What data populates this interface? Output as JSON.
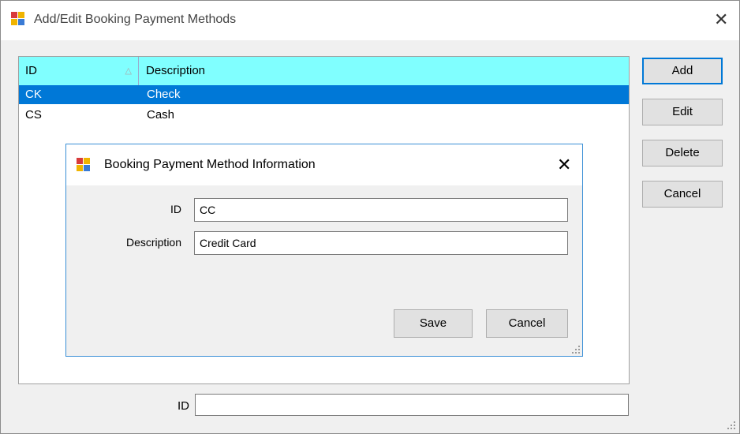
{
  "window": {
    "title": "Add/Edit Booking Payment Methods"
  },
  "grid": {
    "columns": [
      "ID",
      "Description"
    ],
    "sort_indicator": "△",
    "rows": [
      {
        "id": "CK",
        "description": "Check",
        "selected": true
      },
      {
        "id": "CS",
        "description": "Cash",
        "selected": false
      }
    ]
  },
  "buttons": {
    "add": "Add",
    "edit": "Edit",
    "delete": "Delete",
    "cancel": "Cancel"
  },
  "bottom": {
    "id_label": "ID",
    "id_value": ""
  },
  "dialog": {
    "title": "Booking Payment Method Information",
    "id_label": "ID",
    "id_value": "CC",
    "description_label": "Description",
    "description_value": "Credit Card",
    "save_label": "Save",
    "cancel_label": "Cancel"
  },
  "colors": {
    "header": "#80ffff",
    "selection": "#0078d7",
    "dialog_border": "#3a8fd6"
  },
  "icons": {
    "app": "app-window-icon",
    "close": "close-icon"
  }
}
